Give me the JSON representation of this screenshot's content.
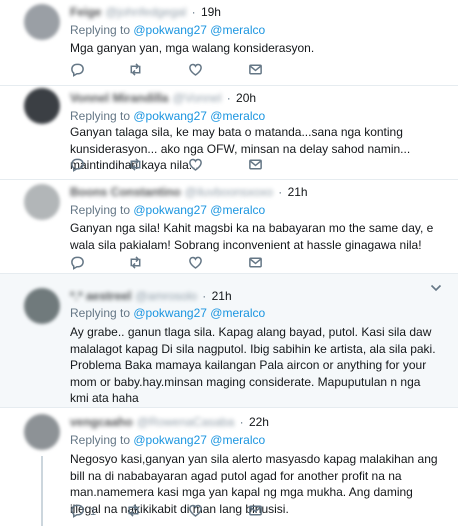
{
  "tweets": [
    {
      "name": "Feige",
      "handle": "@johnfedgegal",
      "time": "19h",
      "replying_prefix": "Replying to ",
      "mentions": [
        "@pokwang27",
        "@meralco"
      ],
      "text": "Mga ganyan yan, mga walang konsiderasyon.",
      "reply_count": "",
      "retweet_count": "",
      "like_count": ""
    },
    {
      "name": "Vonnel Mirandilla",
      "handle": "@Vonnel",
      "time": "20h",
      "replying_prefix": "Replying to ",
      "mentions": [
        "@pokwang27",
        "@meralco"
      ],
      "text": "Ganyan talaga sila, ke may bata o matanda...sana nga konting kunsiderasyon... ako nga OFW, minsan na delay sahod namin... maintindihan kaya nila...",
      "reply_count": "",
      "retweet_count": "",
      "like_count": ""
    },
    {
      "name": "Boons Constantino",
      "handle": "@iluvboonsxoxo",
      "time": "21h",
      "replying_prefix": "Replying to ",
      "mentions": [
        "@pokwang27",
        "@meralco"
      ],
      "text": "Ganyan nga sila! Kahit magsbi ka na babayaran mo the same day, e wala sila pakialam! Sobrang inconvenient at hassle ginagawa nila!",
      "reply_count": "",
      "retweet_count": "",
      "like_count": ""
    },
    {
      "name": "*.* aestreel",
      "handle": "@amrosolo",
      "time": "21h",
      "replying_prefix": "Replying to ",
      "mentions": [
        "@pokwang27",
        "@meralco"
      ],
      "text": "Ay grabe.. ganun tlaga sila. Kapag alang bayad, putol. Kasi sila daw malalagot kapag Di sila nagputol. Ibig sabihin ke artista, ala sila paki. Problema Baka mamaya kailangan Pala aircon or anything for your mom or baby.hay.minsan maging considerate. Mapuputulan n nga kmi ata haha",
      "reply_count": "",
      "retweet_count": "",
      "like_count": ""
    },
    {
      "name": "vengcaaho",
      "handle": "@RowenaCasaba",
      "time": "22h",
      "replying_prefix": "Replying to ",
      "mentions": [
        "@pokwang27",
        "@meralco"
      ],
      "text": "Negosyo kasi,ganyan yan sila alerto masyasdo kapag malakihan ang bill na di nababayaran agad putol agad for another profit na na man.namemera kasi mga yan kapal ng mga mukha. Ang daming illegal na nakikikabit di man lang binusisi.",
      "reply_count": "",
      "retweet_count": "1",
      "like_count": ""
    }
  ],
  "icons": {
    "reply": "reply-icon",
    "retweet": "retweet-icon",
    "like": "heart-icon",
    "dm": "envelope-icon",
    "caret": "chevron-down-icon"
  },
  "colors": {
    "accent": "#1b95e0",
    "muted": "#657786",
    "text": "#14171a",
    "divider": "#e6ecf0",
    "highlight_bg": "#f5f8fa"
  }
}
